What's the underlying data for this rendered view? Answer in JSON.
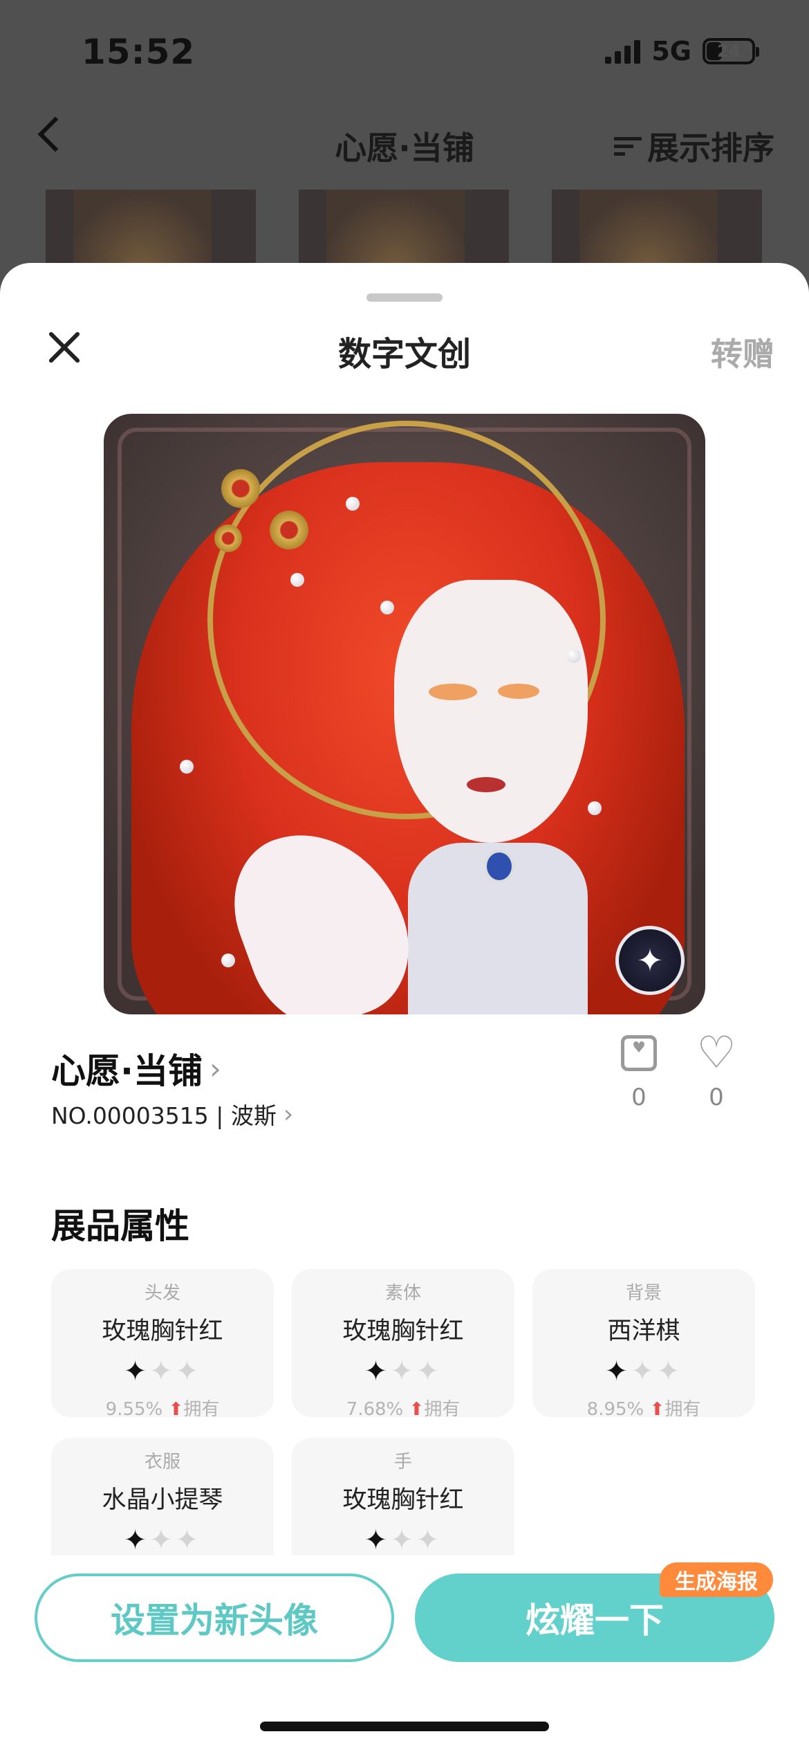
{
  "status": {
    "time": "15:52",
    "network": "5G",
    "battery": "24"
  },
  "background_page": {
    "title": "心愿·当铺",
    "sort_label": "展示排序"
  },
  "sheet": {
    "title": "数字文创",
    "gift_label": "转赠"
  },
  "work": {
    "name": "心愿·当铺",
    "serial": "NO.00003515 | 波斯",
    "frame_count": "0",
    "like_count": "0"
  },
  "section_title": "展品属性",
  "attributes": [
    {
      "category": "头发",
      "value": "玫瑰胸针红",
      "stars": 1,
      "percent": "9.55%",
      "own_label": "拥有"
    },
    {
      "category": "素体",
      "value": "玫瑰胸针红",
      "stars": 1,
      "percent": "7.68%",
      "own_label": "拥有"
    },
    {
      "category": "背景",
      "value": "西洋棋",
      "stars": 1,
      "percent": "8.95%",
      "own_label": "拥有"
    },
    {
      "category": "衣服",
      "value": "水晶小提琴",
      "stars": 1,
      "percent": "",
      "own_label": ""
    },
    {
      "category": "手",
      "value": "玫瑰胸针红",
      "stars": 1,
      "percent": "",
      "own_label": ""
    }
  ],
  "actions": {
    "set_avatar": "设置为新头像",
    "show_off": "炫耀一下",
    "poster_tag": "生成海报"
  },
  "colors": {
    "accent": "#62d0cb",
    "tag": "#ff8a3c",
    "up_arrow": "#e84e4e"
  }
}
